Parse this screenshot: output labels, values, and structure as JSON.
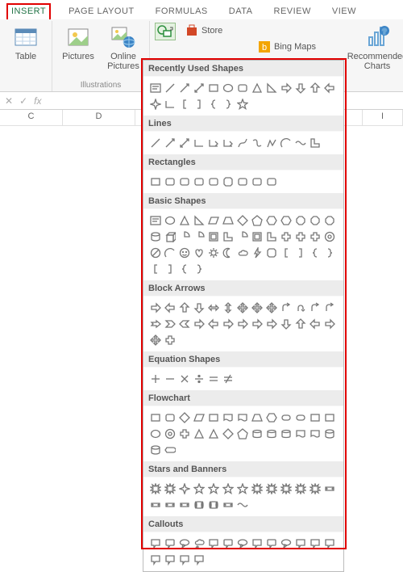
{
  "tabs": {
    "insert": "INSERT",
    "page_layout": "PAGE LAYOUT",
    "formulas": "FORMULAS",
    "data": "DATA",
    "review": "REVIEW",
    "view": "VIEW"
  },
  "ribbon": {
    "table": "Table",
    "pictures": "Pictures",
    "online_pictures": "Online Pictures",
    "illustrations_label": "Illustrations",
    "store": "Store",
    "bing_maps": "Bing Maps",
    "recommended_charts": "Recommended Charts"
  },
  "formula_bar": {
    "cancel": "✕",
    "confirm": "✓",
    "fx": "fx"
  },
  "columns": {
    "c": "C",
    "d": "D",
    "i": "I"
  },
  "shape_menu": {
    "recently_used": "Recently Used Shapes",
    "lines": "Lines",
    "rectangles": "Rectangles",
    "basic_shapes": "Basic Shapes",
    "block_arrows": "Block Arrows",
    "equation_shapes": "Equation Shapes",
    "flowchart": "Flowchart",
    "stars_and_banners": "Stars and Banners",
    "callouts": "Callouts"
  }
}
